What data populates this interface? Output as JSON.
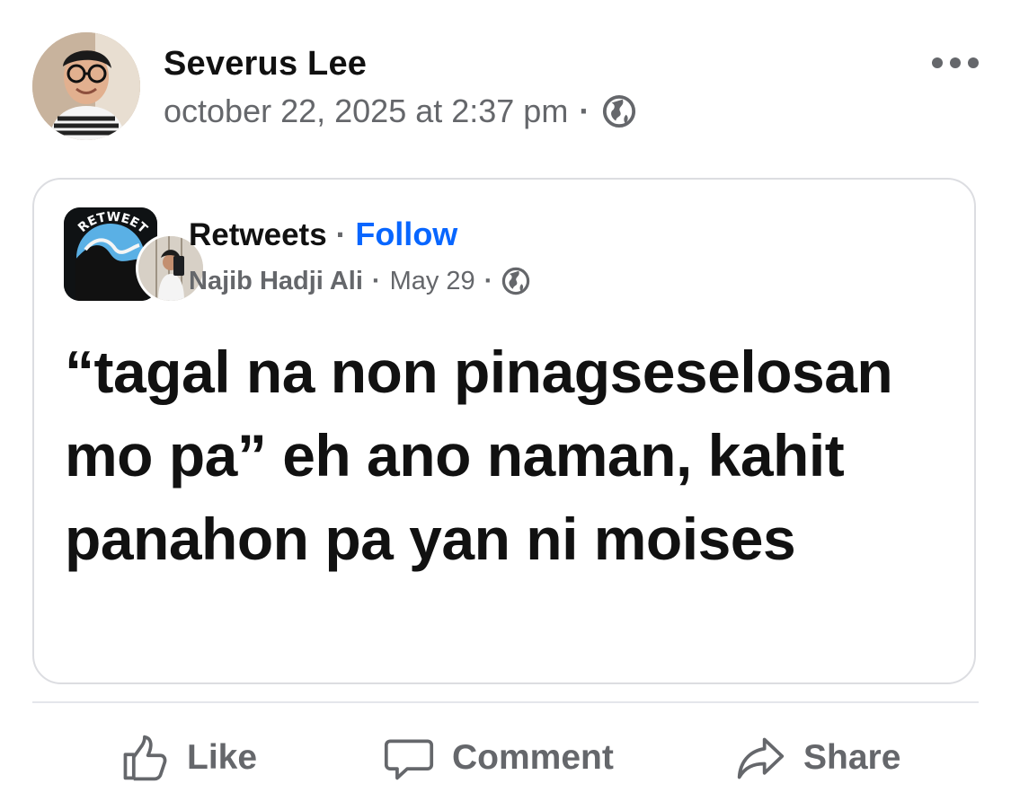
{
  "post": {
    "author": "Severus Lee",
    "timestamp": "october 22, 2025 at 2:37 pm",
    "separator": "·",
    "audience_icon": "globe-icon",
    "menu_icon": "more-horizontal-icon"
  },
  "shared_post": {
    "page_name": "Retweets",
    "separator": "·",
    "follow_label": "Follow",
    "author": "Najib Hadji Ali",
    "date": "May 29",
    "audience_icon": "globe-icon",
    "text": "“tagal na non pinagseselosan mo pa” eh ano naman, kahit panahon pa yan ni moises",
    "page_logo_text": "RETWEETS"
  },
  "actions": [
    {
      "label": "Like",
      "icon": "thumbs-up-icon"
    },
    {
      "label": "Comment",
      "icon": "comment-icon"
    },
    {
      "label": "Share",
      "icon": "share-arrow-icon"
    }
  ],
  "colors": {
    "text": "#050505",
    "secondary_text": "#65676b",
    "link": "#0866ff",
    "border": "#dcdde1"
  }
}
